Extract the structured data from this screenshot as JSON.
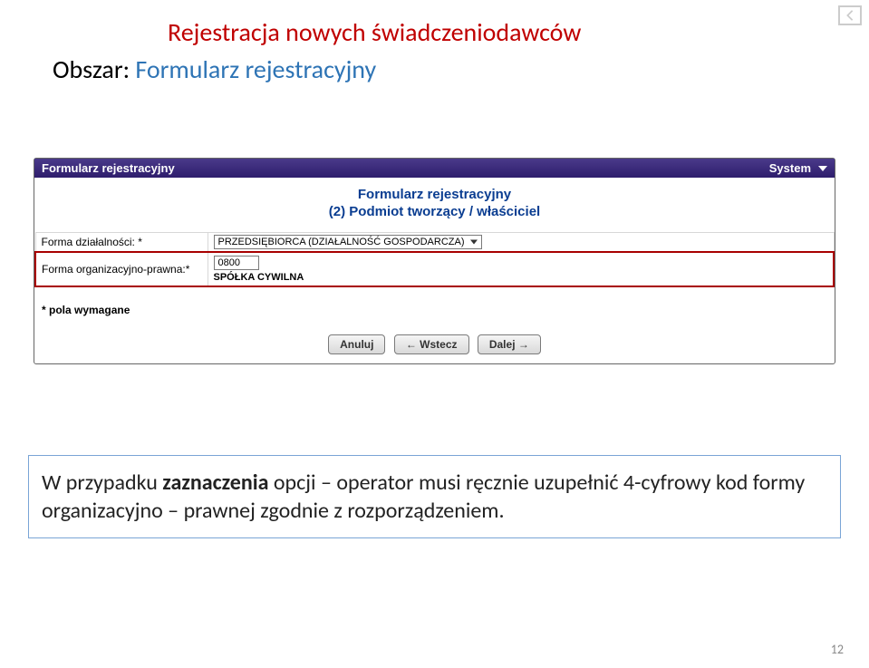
{
  "cornerNav": {
    "icon": "nav-back-icon"
  },
  "title": "Rejestracja nowych świadczeniodawców",
  "subtitle": {
    "label": "Obszar: ",
    "value": "Formularz rejestracyjny"
  },
  "panel": {
    "headerLeft": "Formularz rejestracyjny",
    "headerRight": "System",
    "formTitle": "Formularz rejestracyjny",
    "formSubtitle": "(2) Podmiot tworzący / właściciel",
    "rows": {
      "activity": {
        "label": "Forma działalności: *",
        "value": "PRZEDSIĘBIORCA (DZIAŁALNOŚĆ GOSPODARCZA)"
      },
      "legalForm": {
        "label": "Forma organizacyjno-prawna:*",
        "code": "0800",
        "text": "SPÓŁKA CYWILNA"
      }
    },
    "requiredNote": "* pola wymagane",
    "buttons": {
      "cancel": "Anuluj",
      "back": "←  Wstecz",
      "next": "Dalej  →"
    }
  },
  "infoBox": {
    "prefix": "W przypadku ",
    "bold": "zaznaczenia",
    "rest": " opcji – operator musi ręcznie uzupełnić 4-cyfrowy kod formy organizacyjno – prawnej zgodnie z rozporządzeniem."
  },
  "pageNumber": "12"
}
